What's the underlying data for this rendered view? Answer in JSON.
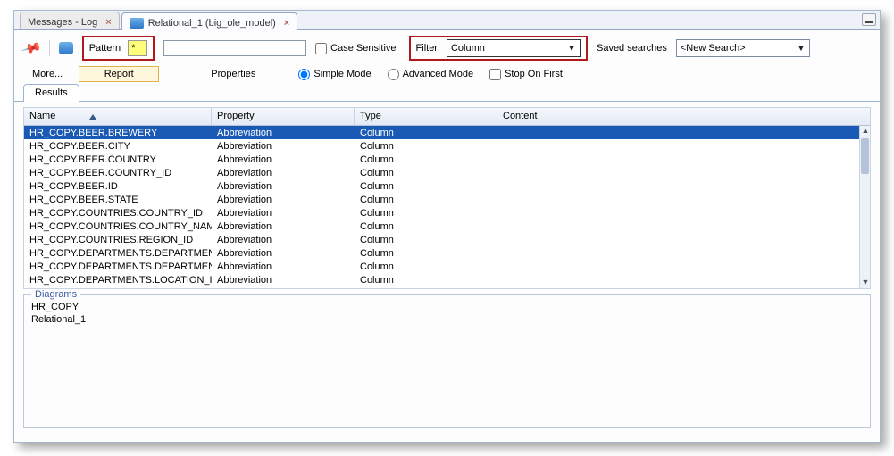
{
  "tabs": [
    {
      "label": "Messages - Log"
    },
    {
      "label": "Relational_1 (big_ole_model)"
    }
  ],
  "form": {
    "pattern_label": "Pattern",
    "pattern_value": "*",
    "search_value": "",
    "case_sensitive_label": "Case Sensitive",
    "filter_label": "Filter",
    "filter_value": "Column",
    "saved_label": "Saved searches",
    "saved_value": "<New Search>",
    "more_label": "More...",
    "report_label": "Report",
    "properties_label": "Properties",
    "simple_mode_label": "Simple Mode",
    "advanced_mode_label": "Advanced Mode",
    "stop_on_first_label": "Stop On First"
  },
  "results": {
    "tab_label": "Results",
    "columns": [
      "Name",
      "Property",
      "Type",
      "Content"
    ],
    "rows": [
      {
        "name": "HR_COPY.BEER.BREWERY",
        "property": "Abbreviation",
        "type": "Column",
        "content": "",
        "selected": true
      },
      {
        "name": "HR_COPY.BEER.CITY",
        "property": "Abbreviation",
        "type": "Column",
        "content": ""
      },
      {
        "name": "HR_COPY.BEER.COUNTRY",
        "property": "Abbreviation",
        "type": "Column",
        "content": ""
      },
      {
        "name": "HR_COPY.BEER.COUNTRY_ID",
        "property": "Abbreviation",
        "type": "Column",
        "content": ""
      },
      {
        "name": "HR_COPY.BEER.ID",
        "property": "Abbreviation",
        "type": "Column",
        "content": ""
      },
      {
        "name": "HR_COPY.BEER.STATE",
        "property": "Abbreviation",
        "type": "Column",
        "content": ""
      },
      {
        "name": "HR_COPY.COUNTRIES.COUNTRY_ID",
        "property": "Abbreviation",
        "type": "Column",
        "content": ""
      },
      {
        "name": "HR_COPY.COUNTRIES.COUNTRY_NAME",
        "property": "Abbreviation",
        "type": "Column",
        "content": ""
      },
      {
        "name": "HR_COPY.COUNTRIES.REGION_ID",
        "property": "Abbreviation",
        "type": "Column",
        "content": ""
      },
      {
        "name": "HR_COPY.DEPARTMENTS.DEPARTMENT...",
        "property": "Abbreviation",
        "type": "Column",
        "content": ""
      },
      {
        "name": "HR_COPY.DEPARTMENTS.DEPARTMENT...",
        "property": "Abbreviation",
        "type": "Column",
        "content": ""
      },
      {
        "name": "HR_COPY.DEPARTMENTS.LOCATION_ID",
        "property": "Abbreviation",
        "type": "Column",
        "content": ""
      }
    ]
  },
  "diagrams": {
    "label": "Diagrams",
    "items": [
      "HR_COPY",
      "Relational_1"
    ]
  }
}
